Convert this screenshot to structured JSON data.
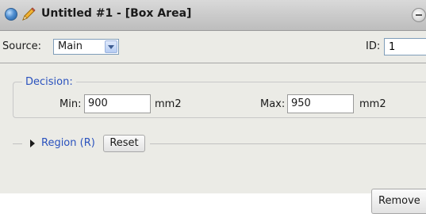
{
  "window": {
    "title": "Untitled #1 - [Box Area]"
  },
  "source": {
    "label": "Source:",
    "selected": "Main"
  },
  "id": {
    "label": "ID:",
    "value": "1"
  },
  "decision": {
    "legend": "Decision:",
    "min_label": "Min:",
    "min_value": "900",
    "min_unit": "mm2",
    "max_label": "Max:",
    "max_value": "950",
    "max_unit": "mm2"
  },
  "region": {
    "label": "Region (R)",
    "reset_label": "Reset"
  },
  "actions": {
    "remove_label": "Remove"
  },
  "colors": {
    "accent_blue": "#2a52be",
    "panel_bg": "#ebebe6"
  },
  "icons": {
    "window_orb": "blue-orb-icon",
    "edit": "pencil-icon",
    "collapse": "minus-circle-icon",
    "dropdown": "chevron-down-icon",
    "region_toggle": "triangle-right-icon"
  }
}
